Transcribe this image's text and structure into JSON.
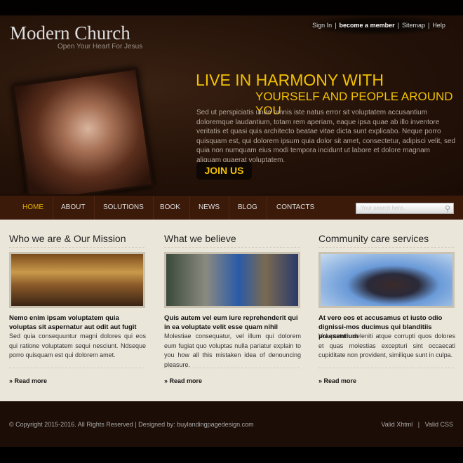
{
  "header": {
    "logo": "Modern Church",
    "tagline": "Open Your Heart For Jesus",
    "top_links": [
      "Sign In",
      "become a member",
      "Sitemap",
      "Help"
    ]
  },
  "hero": {
    "headline_1": "LIVE IN HARMONY WITH",
    "headline_2": "YOURSELF AND PEOPLE AROUND YOU",
    "text": "Sed ut perspiciatis unde omnis iste natus error sit voluptatem accusantium doloremque laudantium, totam rem aperiam, eaque ipsa quae ab illo inventore veritatis et quasi quis architecto beatae vitae dicta sunt explicabo. Neque porro quisquam est, qui dolorem ipsum quia dolor sit amet, consectetur, adipisci velit, sed quia non numquam eius modi tempora incidunt ut labore et dolore magnam aliquam quaerat voluptatem.",
    "button": "JOIN US"
  },
  "nav": {
    "items": [
      "HOME",
      "ABOUT",
      "SOLUTIONS",
      "BOOK",
      "NEWS",
      "BLOG",
      "CONTACTS"
    ],
    "active": "HOME",
    "search_placeholder": "Your search here.."
  },
  "columns": [
    {
      "title": "Who we are & Our Mission",
      "subtitle": "Nemo enim ipsam voluptatem quia voluptas sit aspernatur aut odit aut fugit",
      "text": "Sed quia consequuntur magni dolores qui eos qui ratione voluptatem sequi nesciunt. Ndseque porro quisquam est qui dolorem amet.",
      "link": "» Read more"
    },
    {
      "title": "What we believe",
      "subtitle": "Quis autem vel eum iure reprehenderit qui in ea voluptate velit esse quam nihil",
      "text": "Molestiae consequatur, vel illum qui dolorem eum fugiat quo voluptas nulla pariatur explain to you how all this mistaken idea of denouncing pleasure.",
      "link": "» Read more"
    },
    {
      "title": "Community care services",
      "subtitle": "At vero eos et accusamus et iusto odio dignissi-mos ducimus qui blanditiis praesentium",
      "text": "Voluptatum deleniti atque corrupti quos dolores et quas molestias excepturi sint occaecati cupiditate non provident, similique sunt in culpa.",
      "link": "» Read more"
    }
  ],
  "footer": {
    "copyright": "© Copyright 2015-2016. All Rights Reserved | Designed by:  buylandingpagedesign.com",
    "valid_xhtml": "Valid Xhtml",
    "valid_css": "Valid CSS",
    "separator": "|"
  },
  "colors": {
    "accent": "#f2c200",
    "nav_bg": "#3b1a0a",
    "content_bg": "#ebe6da",
    "footer_bg": "#1c0d06"
  }
}
